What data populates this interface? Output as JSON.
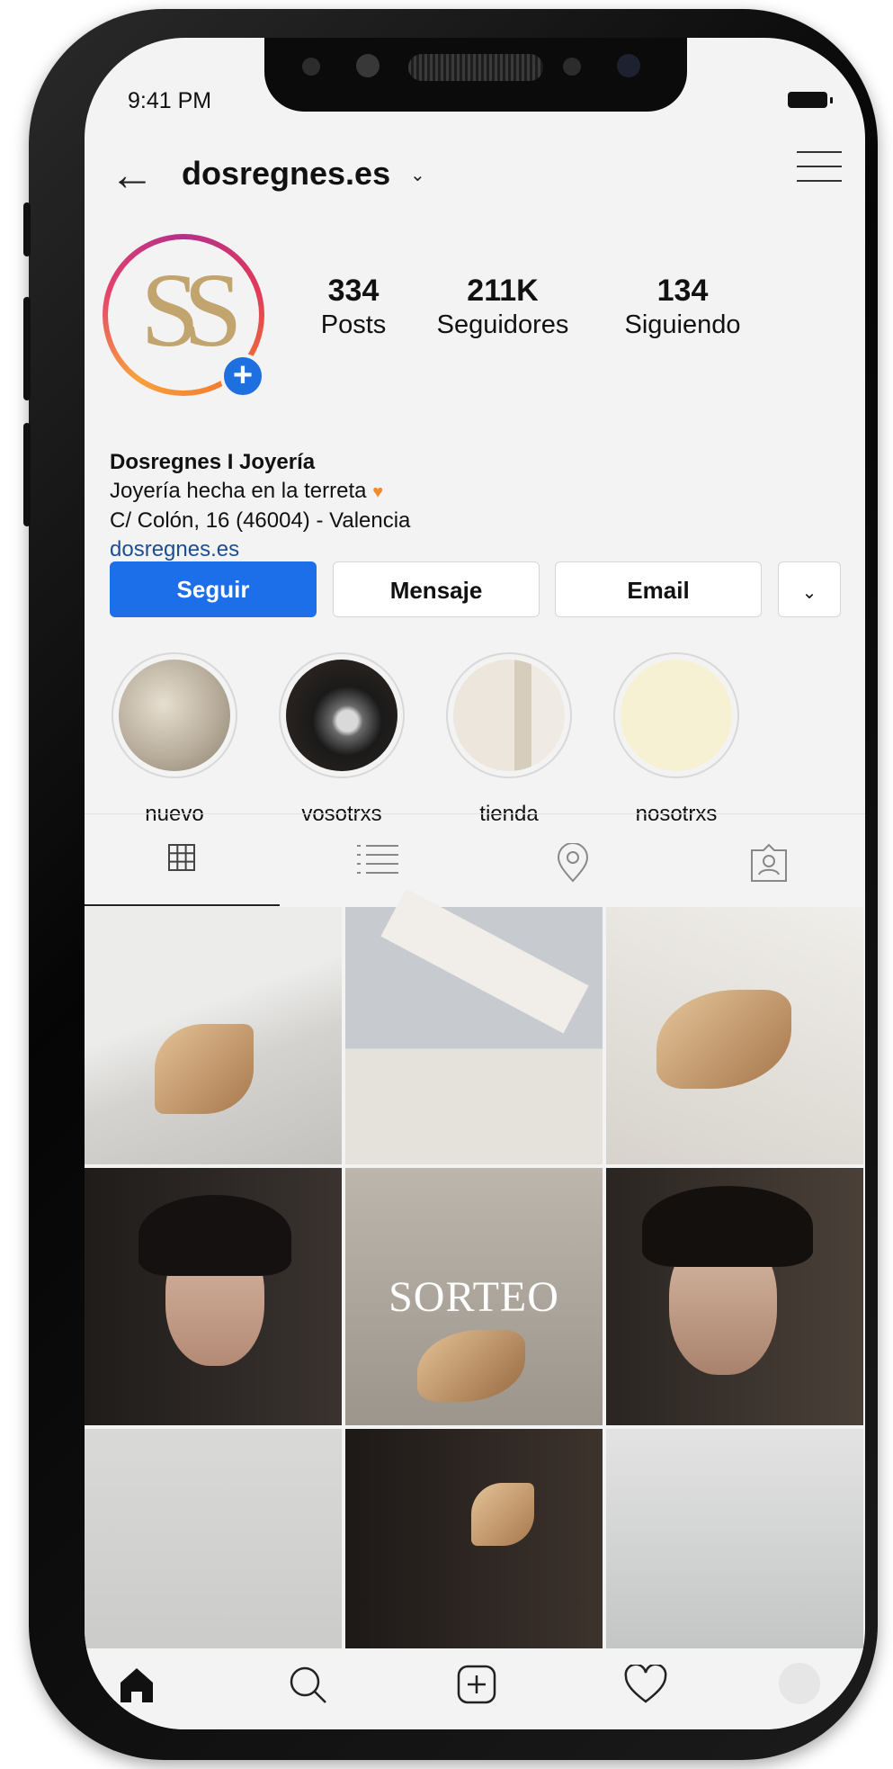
{
  "status_bar": {
    "time": "9:41 PM"
  },
  "header": {
    "username": "dosregnes.es",
    "back_glyph": "←",
    "chevron_glyph": "⌄"
  },
  "profile": {
    "logo_text": "SS",
    "stats": [
      {
        "num": "334",
        "label": "Posts"
      },
      {
        "num": "211K",
        "label": "Seguidores"
      },
      {
        "num": "134",
        "label": "Siguiendo"
      }
    ],
    "name": "Dosregnes I Joyería",
    "bio_line1": "Joyería hecha en la terreta",
    "bio_heart": "♥",
    "bio_line2": "C/ Colón, 16  (46004) - Valencia",
    "website": "dosregnes.es"
  },
  "actions": {
    "follow": "Seguir",
    "message": "Mensaje",
    "email": "Email",
    "more": "⌄"
  },
  "highlights": [
    {
      "label": "nuevo"
    },
    {
      "label": "vosotrxs"
    },
    {
      "label": "tienda"
    },
    {
      "label": "nosotrxs"
    }
  ],
  "grid": {
    "sorteo_text": "SORTEO"
  },
  "colors": {
    "accent": "#1c6fe8",
    "link": "#1d4f8f",
    "logo_gold": "#c2a46e"
  }
}
